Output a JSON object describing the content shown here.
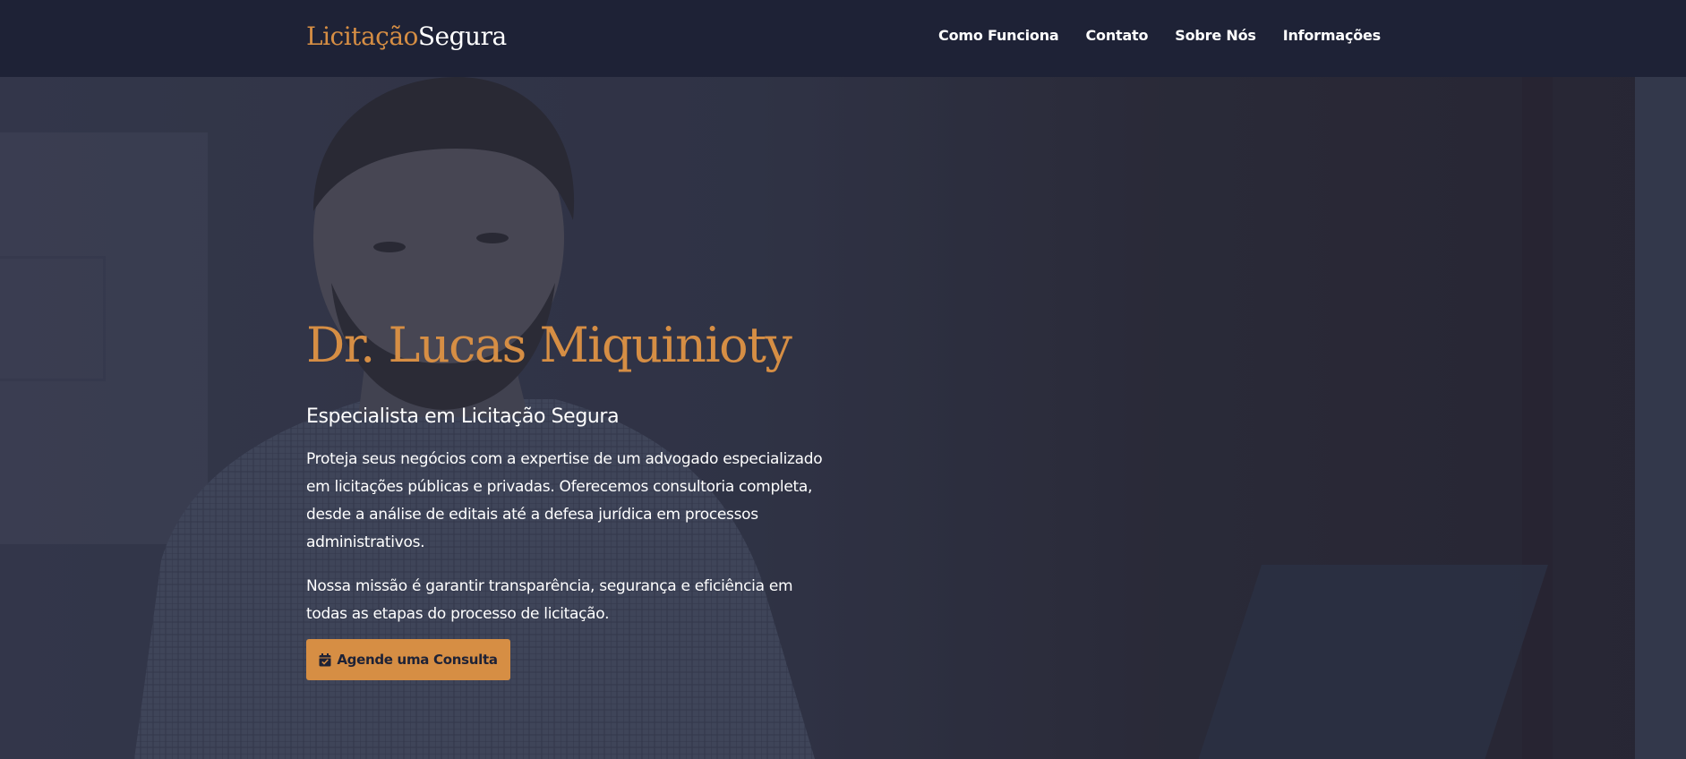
{
  "brand": {
    "part1": "Licitação",
    "part2": "Segura"
  },
  "nav": {
    "items": [
      {
        "label": "Como Funciona"
      },
      {
        "label": "Contato"
      },
      {
        "label": "Sobre Nós"
      },
      {
        "label": "Informações"
      }
    ]
  },
  "hero": {
    "title": "Dr. Lucas Miquinioty",
    "subtitle": "Especialista em Licitação Segura",
    "paragraph1": "Proteja seus negócios com a expertise de um advogado especializado em licitações públicas e privadas. Oferecemos consultoria completa, desde a análise de editais até a defesa jurídica em processos administrativos.",
    "paragraph2": "Nossa missão é garantir transparência, segurança e eficiência em todas as etapas do processo de licitação.",
    "cta_label": "Agende uma Consulta",
    "cta_icon": "calendar-check-icon"
  },
  "colors": {
    "accent": "#d68e44",
    "navbar_bg": "#1e2236",
    "text_light": "#ffffff"
  }
}
